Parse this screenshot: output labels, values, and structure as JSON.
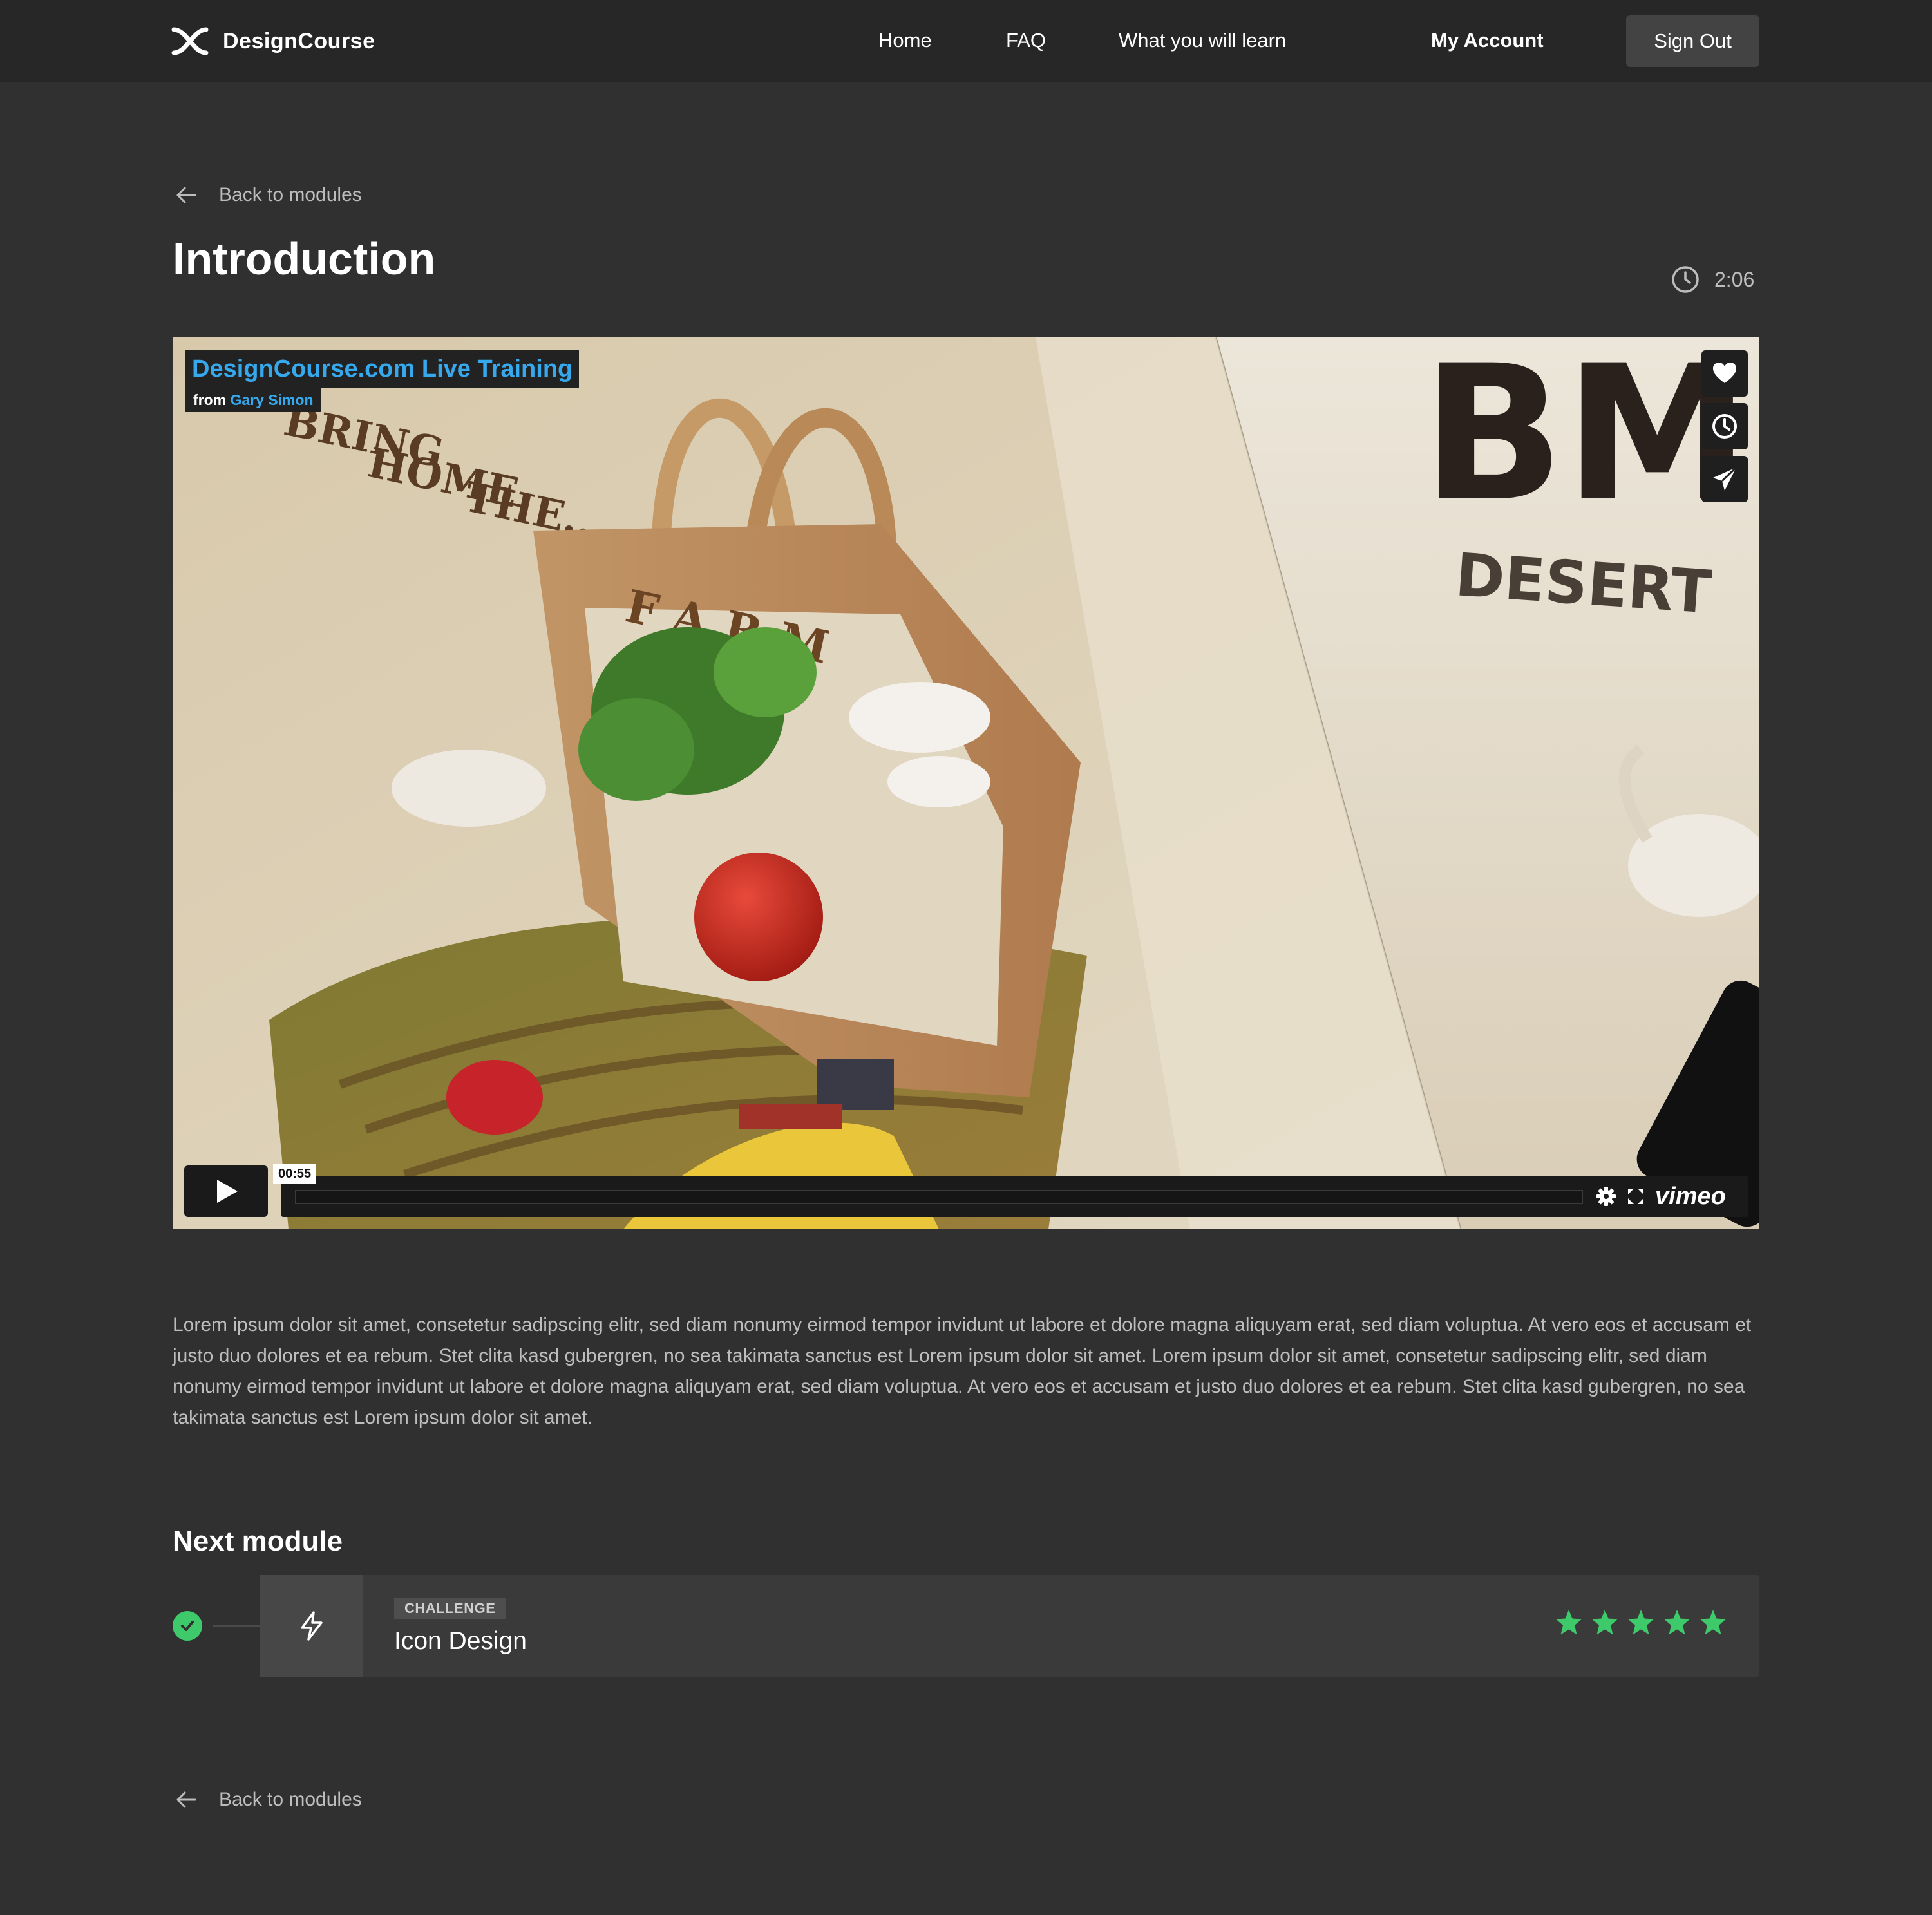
{
  "header": {
    "brand_name": "DesignCourse",
    "nav": {
      "home": "Home",
      "faq": "FAQ",
      "learn": "What you will learn",
      "account": "My Account"
    },
    "sign_out": "Sign Out"
  },
  "back_link": "Back to modules",
  "page": {
    "title": "Introduction",
    "duration": "2:06"
  },
  "video": {
    "badge_title": "DesignCourse.com Live Training",
    "badge_from": "from",
    "badge_author": "Gary Simon",
    "current_time": "00:55",
    "progress": 0.0,
    "player_logo": "vimeo",
    "scene_text": {
      "headline_1": "BRING",
      "headline_2": "HOME",
      "headline_3": "THE...",
      "bag_label": "FARM",
      "right_big": "BM",
      "right_sub": "DESERT"
    },
    "side_icons": [
      "heart-icon",
      "clock-icon",
      "paper-plane-icon"
    ]
  },
  "description": "Lorem ipsum dolor sit amet, consetetur sadipscing elitr, sed diam nonumy eirmod tempor invidunt ut labore et dolore magna aliquyam erat, sed diam voluptua. At vero eos et accusam et justo duo dolores et ea rebum. Stet clita kasd gubergren, no sea takimata sanctus est Lorem ipsum dolor sit amet. Lorem ipsum dolor sit amet, consetetur sadipscing elitr, sed diam nonumy eirmod tempor invidunt ut labore et dolore magna aliquyam erat, sed diam voluptua. At vero eos et accusam et justo duo dolores et ea rebum. Stet clita kasd gubergren, no sea takimata sanctus est Lorem ipsum dolor sit amet.",
  "next_module": {
    "heading": "Next module",
    "tag": "CHALLENGE",
    "name": "Icon Design",
    "icon": "lightning-icon",
    "completed": true,
    "rating": 5,
    "rating_max": 5
  },
  "colors": {
    "page_bg": "#303030",
    "header_bg": "#272727",
    "card_bg": "#3a3a3a",
    "accent_green": "#3ec96b",
    "badge_blue": "#36a9ee",
    "muted_text": "#bdbdbd"
  }
}
